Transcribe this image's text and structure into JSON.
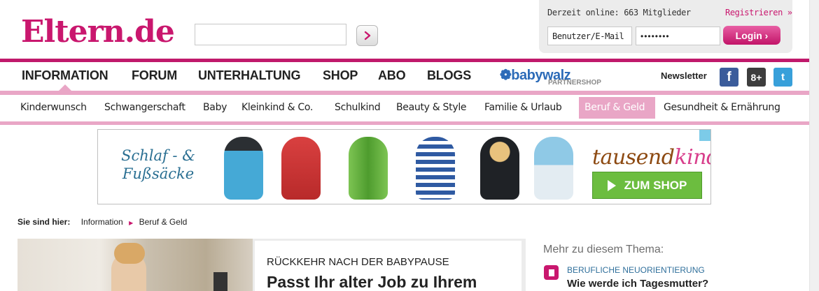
{
  "header": {
    "logo": "Eltern.de",
    "online_text": "Derzeit online: 663 Mitglieder",
    "register_label": "Registrieren »",
    "user_field_value": "Benutzer/E-Mail",
    "password_value": "••••••••",
    "login_label": "Login ›"
  },
  "nav_main": {
    "items": [
      "INFORMATION",
      "FORUM",
      "UNTERHALTUNG",
      "SHOP",
      "ABO",
      "BLOGS"
    ],
    "partner_logo": "❁babywalz",
    "partner_sub": "PARTNERSHOP",
    "newsletter": "Newsletter",
    "social": [
      "f",
      "8+",
      "t"
    ]
  },
  "nav_sub": {
    "items": [
      "Kinderwunsch",
      "Schwangerschaft",
      "Baby",
      "Kleinkind & Co.",
      "Schulkind",
      "Beauty & Style",
      "Familie & Urlaub",
      "Beruf & Geld",
      "Gesundheit & Ernährung"
    ],
    "active": "Beruf & Geld"
  },
  "ad": {
    "title_line1": "Schlaf - &",
    "title_line2": "Fußsäcke",
    "brand_part1": "tausend",
    "brand_part2": "kind",
    "shop_button": "ZUM SHOP"
  },
  "breadcrumb": {
    "label": "Sie sind hier:",
    "items": [
      "Information",
      "Beruf & Geld"
    ]
  },
  "teaser": {
    "kicker": "RÜCKKEHR NACH DER BABYPAUSE",
    "title": "Passt Ihr alter Job zu Ihrem"
  },
  "more": {
    "heading": "Mehr zu diesem Thema:",
    "kicker": "BERUFLICHE NEUORIENTIERUNG",
    "title": "Wie werde ich Tagesmutter?"
  },
  "colors": {
    "brand": "#c9176e",
    "brand_light": "#e9a6c6",
    "shop_green": "#6cbd3f"
  }
}
